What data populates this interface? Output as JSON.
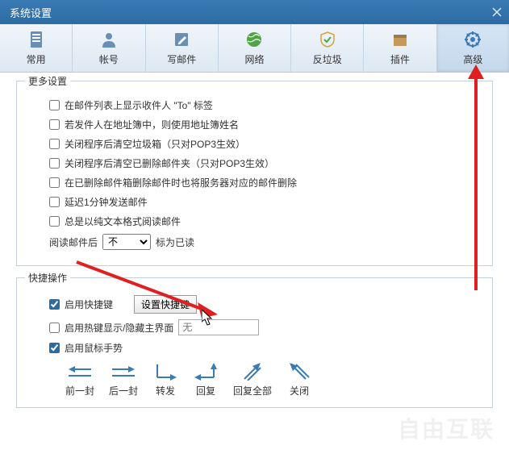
{
  "titlebar": {
    "title": "系统设置"
  },
  "toolbar": {
    "items": [
      {
        "label": "常用",
        "icon": "page"
      },
      {
        "label": "帐号",
        "icon": "user"
      },
      {
        "label": "写邮件",
        "icon": "compose"
      },
      {
        "label": "网络",
        "icon": "globe"
      },
      {
        "label": "反垃圾",
        "icon": "shield"
      },
      {
        "label": "插件",
        "icon": "package"
      },
      {
        "label": "高级",
        "icon": "gear"
      }
    ],
    "active": 6
  },
  "more_settings": {
    "title": "更多设置",
    "items": [
      "在邮件列表上显示收件人 \"To\" 标签",
      "若发件人在地址簿中，则使用地址簿姓名",
      "关闭程序后清空垃圾箱（只对POP3生效）",
      "关闭程序后清空已删除邮件夹（只对POP3生效）",
      "在已删除邮件箱删除邮件时也将服务器对应的邮件删除",
      "延迟1分钟发送邮件",
      "总是以纯文本格式阅读邮件"
    ],
    "read_row": {
      "prefix": "阅读邮件后",
      "select_value": "不",
      "suffix": "标为已读"
    }
  },
  "shortcut_ops": {
    "title": "快捷操作",
    "enable_shortcut": "启用快捷键",
    "set_shortcut_btn": "设置快捷键",
    "enable_hotkey": "启用热键显示/隐藏主界面",
    "hotkey_placeholder": "无",
    "enable_gesture": "启用鼠标手势",
    "gestures": [
      "前一封",
      "后一封",
      "转发",
      "回复",
      "回复全部",
      "关闭"
    ]
  }
}
